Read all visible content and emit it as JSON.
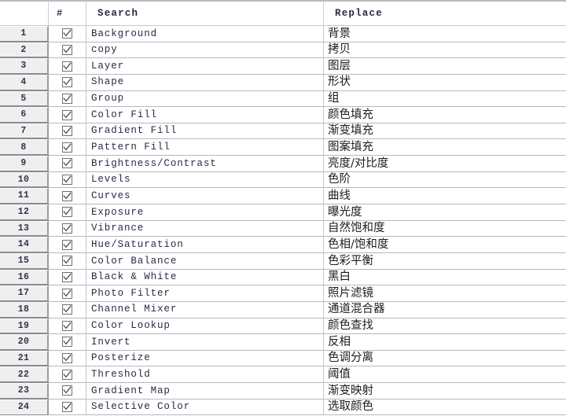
{
  "table": {
    "columns": [
      {
        "key": "num",
        "label": "",
        "name": "row-number-column"
      },
      {
        "key": "check",
        "label": "#",
        "name": "checkbox-column"
      },
      {
        "key": "search",
        "label": "Search",
        "name": "search-column"
      },
      {
        "key": "replace",
        "label": "Replace",
        "name": "replace-column"
      }
    ],
    "header": {
      "corner_label": "",
      "hash_label": "#",
      "search_label": "Search",
      "replace_label": "Replace"
    },
    "checkbox_state": "checked",
    "check_icon": "checkmark-icon",
    "row_count": 24,
    "rows": [
      {
        "num": "1",
        "checked": true,
        "search": "Background",
        "replace": "背景"
      },
      {
        "num": "2",
        "checked": true,
        "search": "copy",
        "replace": "拷贝"
      },
      {
        "num": "3",
        "checked": true,
        "search": "Layer",
        "replace": "图层"
      },
      {
        "num": "4",
        "checked": true,
        "search": "Shape",
        "replace": "形状"
      },
      {
        "num": "5",
        "checked": true,
        "search": "Group",
        "replace": "组"
      },
      {
        "num": "6",
        "checked": true,
        "search": "Color Fill",
        "replace": "颜色填充"
      },
      {
        "num": "7",
        "checked": true,
        "search": "Gradient Fill",
        "replace": "渐变填充"
      },
      {
        "num": "8",
        "checked": true,
        "search": "Pattern Fill",
        "replace": "图案填充"
      },
      {
        "num": "9",
        "checked": true,
        "search": "Brightness/Contrast",
        "replace": "亮度/对比度"
      },
      {
        "num": "10",
        "checked": true,
        "search": "Levels",
        "replace": "色阶"
      },
      {
        "num": "11",
        "checked": true,
        "search": "Curves",
        "replace": "曲线"
      },
      {
        "num": "12",
        "checked": true,
        "search": "Exposure",
        "replace": "曝光度"
      },
      {
        "num": "13",
        "checked": true,
        "search": "Vibrance",
        "replace": "自然饱和度"
      },
      {
        "num": "14",
        "checked": true,
        "search": "Hue/Saturation",
        "replace": "色相/饱和度"
      },
      {
        "num": "15",
        "checked": true,
        "search": "Color Balance",
        "replace": "色彩平衡"
      },
      {
        "num": "16",
        "checked": true,
        "search": "Black & White",
        "replace": "黑白"
      },
      {
        "num": "17",
        "checked": true,
        "search": "Photo Filter",
        "replace": "照片滤镜"
      },
      {
        "num": "18",
        "checked": true,
        "search": "Channel Mixer",
        "replace": "通道混合器"
      },
      {
        "num": "19",
        "checked": true,
        "search": "Color Lookup",
        "replace": "颜色查找"
      },
      {
        "num": "20",
        "checked": true,
        "search": "Invert",
        "replace": "反相"
      },
      {
        "num": "21",
        "checked": true,
        "search": "Posterize",
        "replace": "色调分离"
      },
      {
        "num": "22",
        "checked": true,
        "search": "Threshold",
        "replace": "阈值"
      },
      {
        "num": "23",
        "checked": true,
        "search": "Gradient Map",
        "replace": "渐变映射"
      },
      {
        "num": "24",
        "checked": true,
        "search": "Selective Color",
        "replace": "选取颜色"
      }
    ]
  },
  "colors": {
    "row_header_bg": "#efefef",
    "grid_line": "#b8b8bd",
    "text": "#2a2a46",
    "cjk_text": "#1d1d1d",
    "page_bg": "#ffffff"
  }
}
